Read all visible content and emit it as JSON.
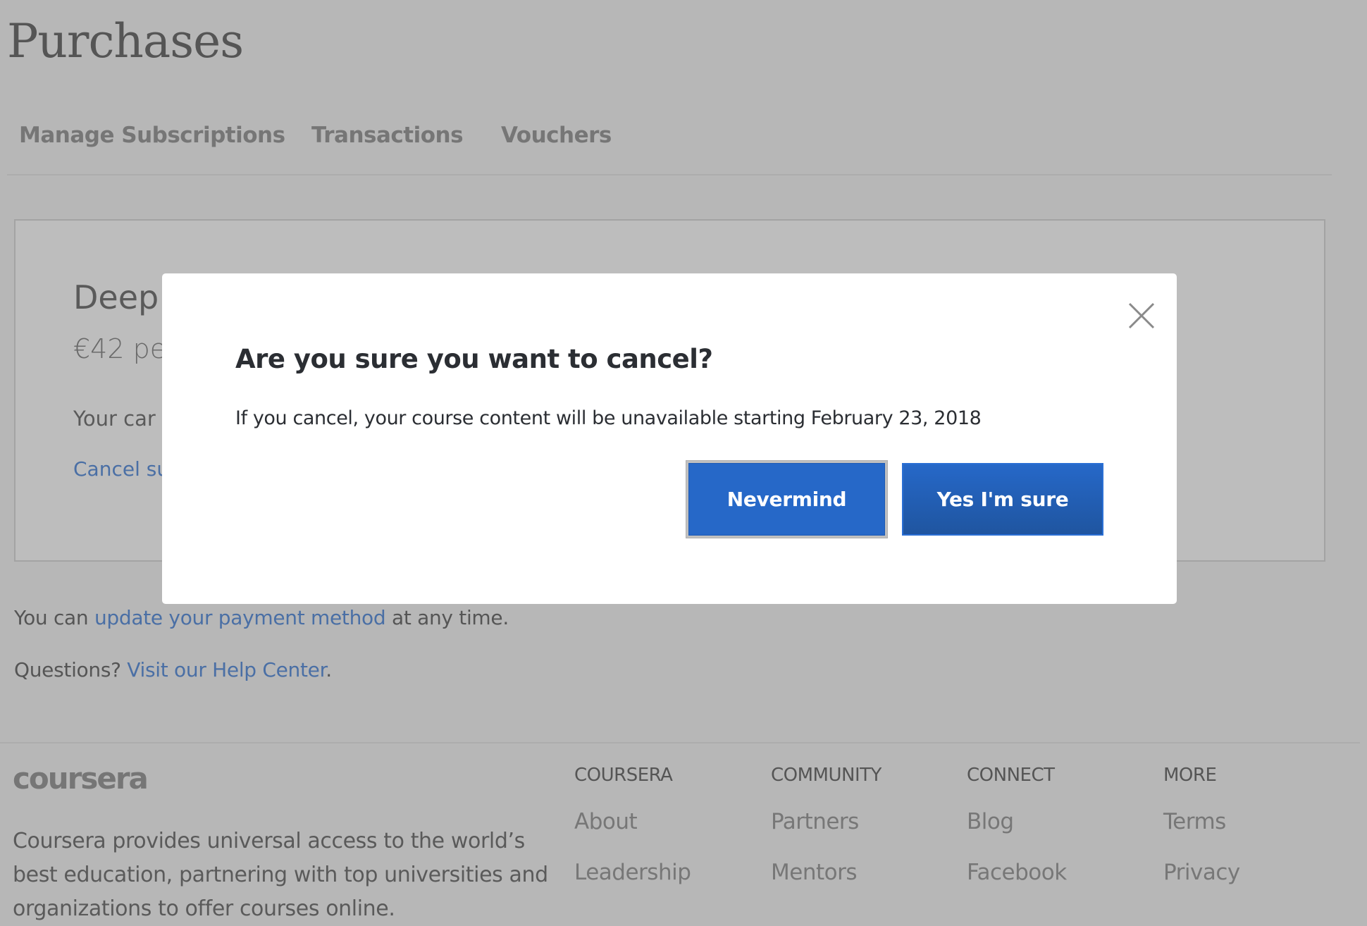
{
  "page": {
    "title": "Purchases"
  },
  "tabs": [
    {
      "label": "Manage Subscriptions"
    },
    {
      "label": "Transactions"
    },
    {
      "label": "Vouchers"
    }
  ],
  "subscription_card": {
    "title_visible": "Deep",
    "price_visible": "€42 pe",
    "note_visible": "Your car",
    "cancel_link_visible": "Cancel sub"
  },
  "info": {
    "payment_prefix": "You can ",
    "payment_link": "update your payment method",
    "payment_suffix": " at any time.",
    "questions_prefix": "Questions? ",
    "help_link": "Visit our Help Center",
    "help_suffix": "."
  },
  "footer": {
    "logo": "coursera",
    "description": "Coursera provides universal access to the world’s best education, partnering with top universities and organizations to offer courses online.",
    "columns": [
      {
        "heading": "COURSERA",
        "links": [
          "About",
          "Leadership"
        ]
      },
      {
        "heading": "COMMUNITY",
        "links": [
          "Partners",
          "Mentors"
        ]
      },
      {
        "heading": "CONNECT",
        "links": [
          "Blog",
          "Facebook"
        ]
      },
      {
        "heading": "MORE",
        "links": [
          "Terms",
          "Privacy"
        ]
      }
    ]
  },
  "modal": {
    "heading": "Are you sure you want to cancel?",
    "body": "If you cancel, your course content will be unavailable starting February 23, 2018",
    "nevermind_label": "Nevermind",
    "confirm_label": "Yes I'm sure",
    "close_icon": "close-icon"
  },
  "colors": {
    "primary_button": "#2668c8",
    "link": "#4a6fa5",
    "overlay_background": "#b7b7b7"
  }
}
